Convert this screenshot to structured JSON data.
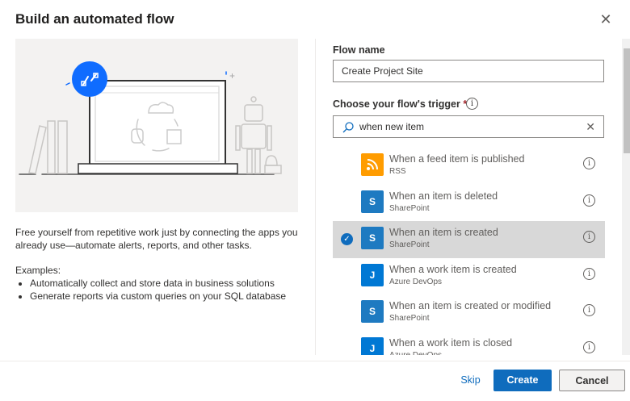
{
  "dialog": {
    "title": "Build an automated flow",
    "close_icon": "close-icon"
  },
  "left": {
    "description": "Free yourself from repetitive work just by connecting the apps you already use—automate alerts, reports, and other tasks.",
    "examples_label": "Examples:",
    "examples": [
      "Automatically collect and store data in business solutions",
      "Generate reports via custom queries on your SQL database"
    ]
  },
  "form": {
    "flow_name_label": "Flow name",
    "flow_name_value": "Create Project Site",
    "trigger_label": "Choose your flow's trigger",
    "required_mark": "*",
    "search_value": "when new item"
  },
  "triggers": [
    {
      "title": "When a feed item is published",
      "connector": "RSS",
      "color": "#ff9c00",
      "glyph": "rss",
      "selected": false
    },
    {
      "title": "When an item is deleted",
      "connector": "SharePoint",
      "color": "#1e7ac1",
      "glyph": "S",
      "selected": false
    },
    {
      "title": "When an item is created",
      "connector": "SharePoint",
      "color": "#1e7ac1",
      "glyph": "S",
      "selected": true
    },
    {
      "title": "When a work item is created",
      "connector": "Azure DevOps",
      "color": "#0078d4",
      "glyph": "J",
      "selected": false
    },
    {
      "title": "When an item is created or modified",
      "connector": "SharePoint",
      "color": "#1e7ac1",
      "glyph": "S",
      "selected": false
    },
    {
      "title": "When a work item is closed",
      "connector": "Azure DevOps",
      "color": "#0078d4",
      "glyph": "J",
      "selected": false
    }
  ],
  "footer": {
    "skip": "Skip",
    "create": "Create",
    "cancel": "Cancel"
  },
  "colors": {
    "accent": "#0f6cbd"
  }
}
